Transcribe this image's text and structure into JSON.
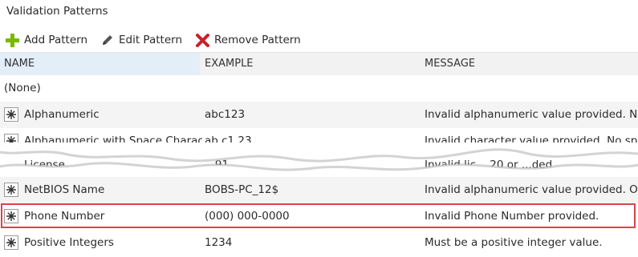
{
  "panel": {
    "title": "Validation Patterns"
  },
  "toolbar": {
    "add_label": "Add Pattern",
    "edit_label": "Edit Pattern",
    "remove_label": "Remove Pattern"
  },
  "table": {
    "columns": [
      "NAME",
      "EXAMPLE",
      "MESSAGE"
    ],
    "none_row": "(None)",
    "rows": [
      {
        "name": "Alphanumeric",
        "example": "abc123",
        "message": "Invalid alphanumeric value provided. No s"
      },
      {
        "name": "Alphanumeric with Space Characte",
        "example": "ab c1 23",
        "message": "Invalid character value provided. No speci"
      },
      {
        "name": "License",
        "example": "...91",
        "message": "Invalid lic... 20 or ...ded"
      },
      {
        "name": "NetBIOS Name",
        "example": "BOBS-PC_12$",
        "message": "Invalid alphanumeric value provided. Only"
      },
      {
        "name": "Phone Number",
        "example": "(000) 000-0000",
        "message": "Invalid Phone Number provided."
      },
      {
        "name": "Positive Integers",
        "example": "1234",
        "message": "Must be a positive integer value."
      }
    ]
  },
  "colors": {
    "highlight": "#d9434b",
    "add_icon": "#7ab800",
    "remove_icon": "#c8222a",
    "header_selected": "#e3eef9"
  },
  "icons": {
    "add": "plus-icon",
    "edit": "pencil-icon",
    "remove": "x-icon",
    "pattern": "asterisk-icon"
  }
}
